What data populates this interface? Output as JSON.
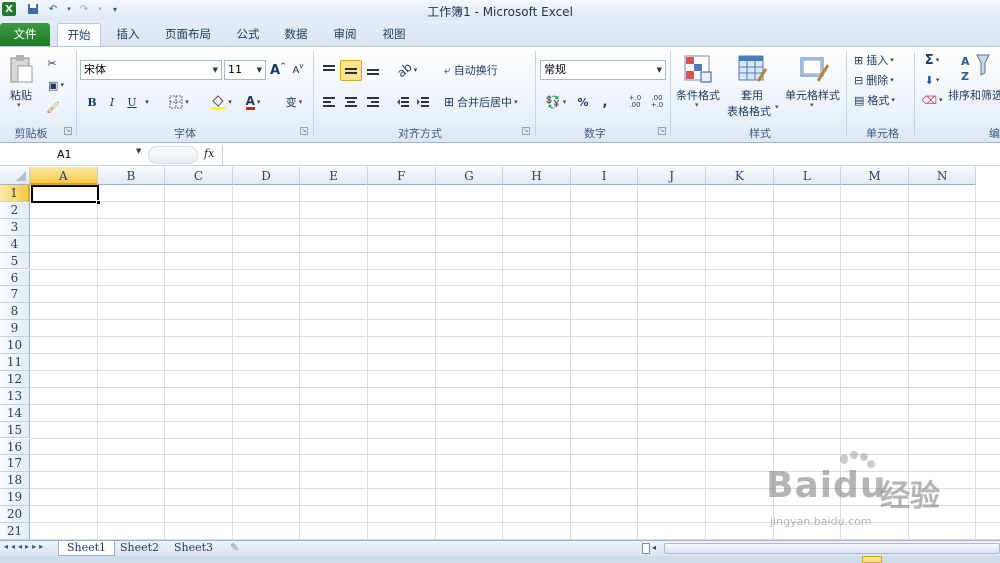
{
  "window": {
    "title": "工作簿1 - Microsoft Excel"
  },
  "tabs": [
    "文件",
    "开始",
    "插入",
    "页面布局",
    "公式",
    "数据",
    "审阅",
    "视图"
  ],
  "ribbon": {
    "clipboard": {
      "paste": "粘贴",
      "label": "剪贴板"
    },
    "font": {
      "name": "宋体",
      "size": "11",
      "bold": "B",
      "italic": "I",
      "underline": "U",
      "label": "字体",
      "grow": "A",
      "shrink": "A",
      "font_color": "A",
      "phonetic": "变"
    },
    "alignment": {
      "wrap": "自动换行",
      "merge": "合并后居中",
      "label": "对齐方式"
    },
    "number": {
      "format": "常规",
      "percent": "%",
      "comma": ",",
      "inc_decimal": "+.0 .00",
      "dec_decimal": ".00 +.0",
      "label": "数字"
    },
    "styles": {
      "conditional": "条件格式",
      "table_line1": "套用",
      "table_line2": "表格格式",
      "cell_styles": "单元格样式",
      "label": "样式"
    },
    "cells": {
      "insert": "插入",
      "delete": "删除",
      "format": "格式",
      "label": "单元格"
    },
    "editing": {
      "sum": "Σ",
      "sort_filter": "排序和筛选",
      "label": "编辑"
    }
  },
  "formula_bar": {
    "name_box": "A1",
    "fx": "fx",
    "value": ""
  },
  "grid": {
    "columns": [
      "A",
      "B",
      "C",
      "D",
      "E",
      "F",
      "G",
      "H",
      "I",
      "J",
      "K",
      "L",
      "M",
      "N"
    ],
    "rows": [
      "1",
      "2",
      "3",
      "4",
      "5",
      "6",
      "7",
      "8",
      "9",
      "10",
      "11",
      "12",
      "13",
      "14",
      "15",
      "16",
      "17",
      "18",
      "19",
      "20",
      "21"
    ],
    "selected_cell": "A1"
  },
  "sheets": [
    "Sheet1",
    "Sheet2",
    "Sheet3"
  ],
  "watermark": {
    "brand": "Baidu",
    "brand_cn": "经验",
    "url": "jingyan.baidu.com"
  },
  "colors": {
    "file_tab": "#1e7a25",
    "selection": "#000000",
    "header_active": "#f7c948"
  }
}
